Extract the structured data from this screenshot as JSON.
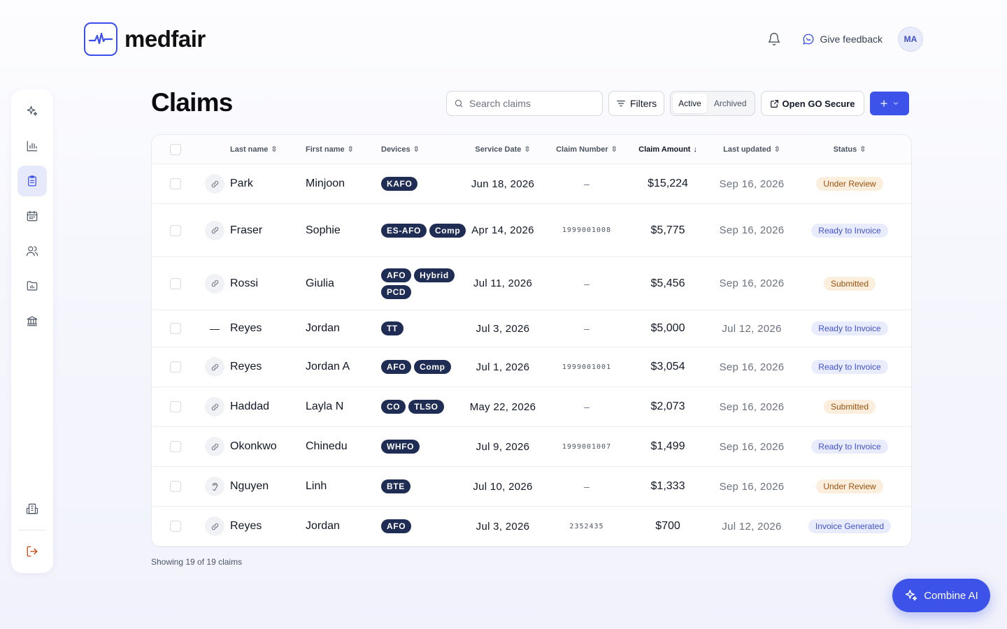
{
  "app": {
    "name": "medfair"
  },
  "header": {
    "feedback_label": "Give feedback",
    "avatar_initials": "MA"
  },
  "page": {
    "title": "Claims"
  },
  "toolbar": {
    "search_placeholder": "Search claims",
    "filters_label": "Filters",
    "seg_active": "Active",
    "seg_archived": "Archived",
    "open_go_label": "Open GO Secure"
  },
  "columns": {
    "last_name": "Last name",
    "first_name": "First name",
    "devices": "Devices",
    "service_date": "Service Date",
    "claim_number": "Claim Number",
    "claim_amount": "Claim Amount",
    "last_updated": "Last updated",
    "status": "Status"
  },
  "rows": [
    {
      "icon": "link",
      "last": "Park",
      "first": "Minjoon",
      "devices": [
        "KAFO"
      ],
      "service_date": "Jun 18, 2026",
      "claim_number": "–",
      "amount": "$15,224",
      "updated": "Sep 16, 2026",
      "status": "Under Review",
      "status_type": "review"
    },
    {
      "icon": "link",
      "last": "Fraser",
      "first": "Sophie",
      "devices": [
        "ES-AFO",
        "Comp"
      ],
      "service_date": "Apr 14, 2026",
      "claim_number": "1999001008",
      "amount": "$5,775",
      "updated": "Sep 16, 2026",
      "status": "Ready to Invoice",
      "status_type": "ready"
    },
    {
      "icon": "link",
      "last": "Rossi",
      "first": "Giulia",
      "devices": [
        "AFO",
        "Hybrid",
        "PCD"
      ],
      "service_date": "Jul 11, 2026",
      "claim_number": "–",
      "amount": "$5,456",
      "updated": "Sep 16, 2026",
      "status": "Submitted",
      "status_type": "sub"
    },
    {
      "icon": "dash",
      "last": "Reyes",
      "first": "Jordan",
      "devices": [
        "TT"
      ],
      "service_date": "Jul 3, 2026",
      "claim_number": "–",
      "amount": "$5,000",
      "updated": "Jul 12, 2026",
      "status": "Ready to Invoice",
      "status_type": "ready"
    },
    {
      "icon": "link",
      "last": "Reyes",
      "first": "Jordan A",
      "devices": [
        "AFO",
        "Comp"
      ],
      "service_date": "Jul 1, 2026",
      "claim_number": "1999001001",
      "amount": "$3,054",
      "updated": "Sep 16, 2026",
      "status": "Ready to Invoice",
      "status_type": "ready"
    },
    {
      "icon": "link",
      "last": "Haddad",
      "first": "Layla N",
      "devices": [
        "CO",
        "TLSO"
      ],
      "service_date": "May 22, 2026",
      "claim_number": "–",
      "amount": "$2,073",
      "updated": "Sep 16, 2026",
      "status": "Submitted",
      "status_type": "sub"
    },
    {
      "icon": "link",
      "last": "Okonkwo",
      "first": "Chinedu",
      "devices": [
        "WHFO"
      ],
      "service_date": "Jul 9, 2026",
      "claim_number": "1999001007",
      "amount": "$1,499",
      "updated": "Sep 16, 2026",
      "status": "Ready to Invoice",
      "status_type": "ready"
    },
    {
      "icon": "ear",
      "last": "Nguyen",
      "first": "Linh",
      "devices": [
        "BTE"
      ],
      "service_date": "Jul 10, 2026",
      "claim_number": "–",
      "amount": "$1,333",
      "updated": "Sep 16, 2026",
      "status": "Under Review",
      "status_type": "review"
    },
    {
      "icon": "link",
      "last": "Reyes",
      "first": "Jordan",
      "devices": [
        "AFO"
      ],
      "service_date": "Jul 3, 2026",
      "claim_number": "2352435",
      "amount": "$700",
      "updated": "Jul 12, 2026",
      "status": "Invoice Generated",
      "status_type": "inv"
    }
  ],
  "footer": {
    "count_text": "Showing 19 of 19 claims"
  },
  "ai_button": {
    "label": "Combine AI"
  }
}
